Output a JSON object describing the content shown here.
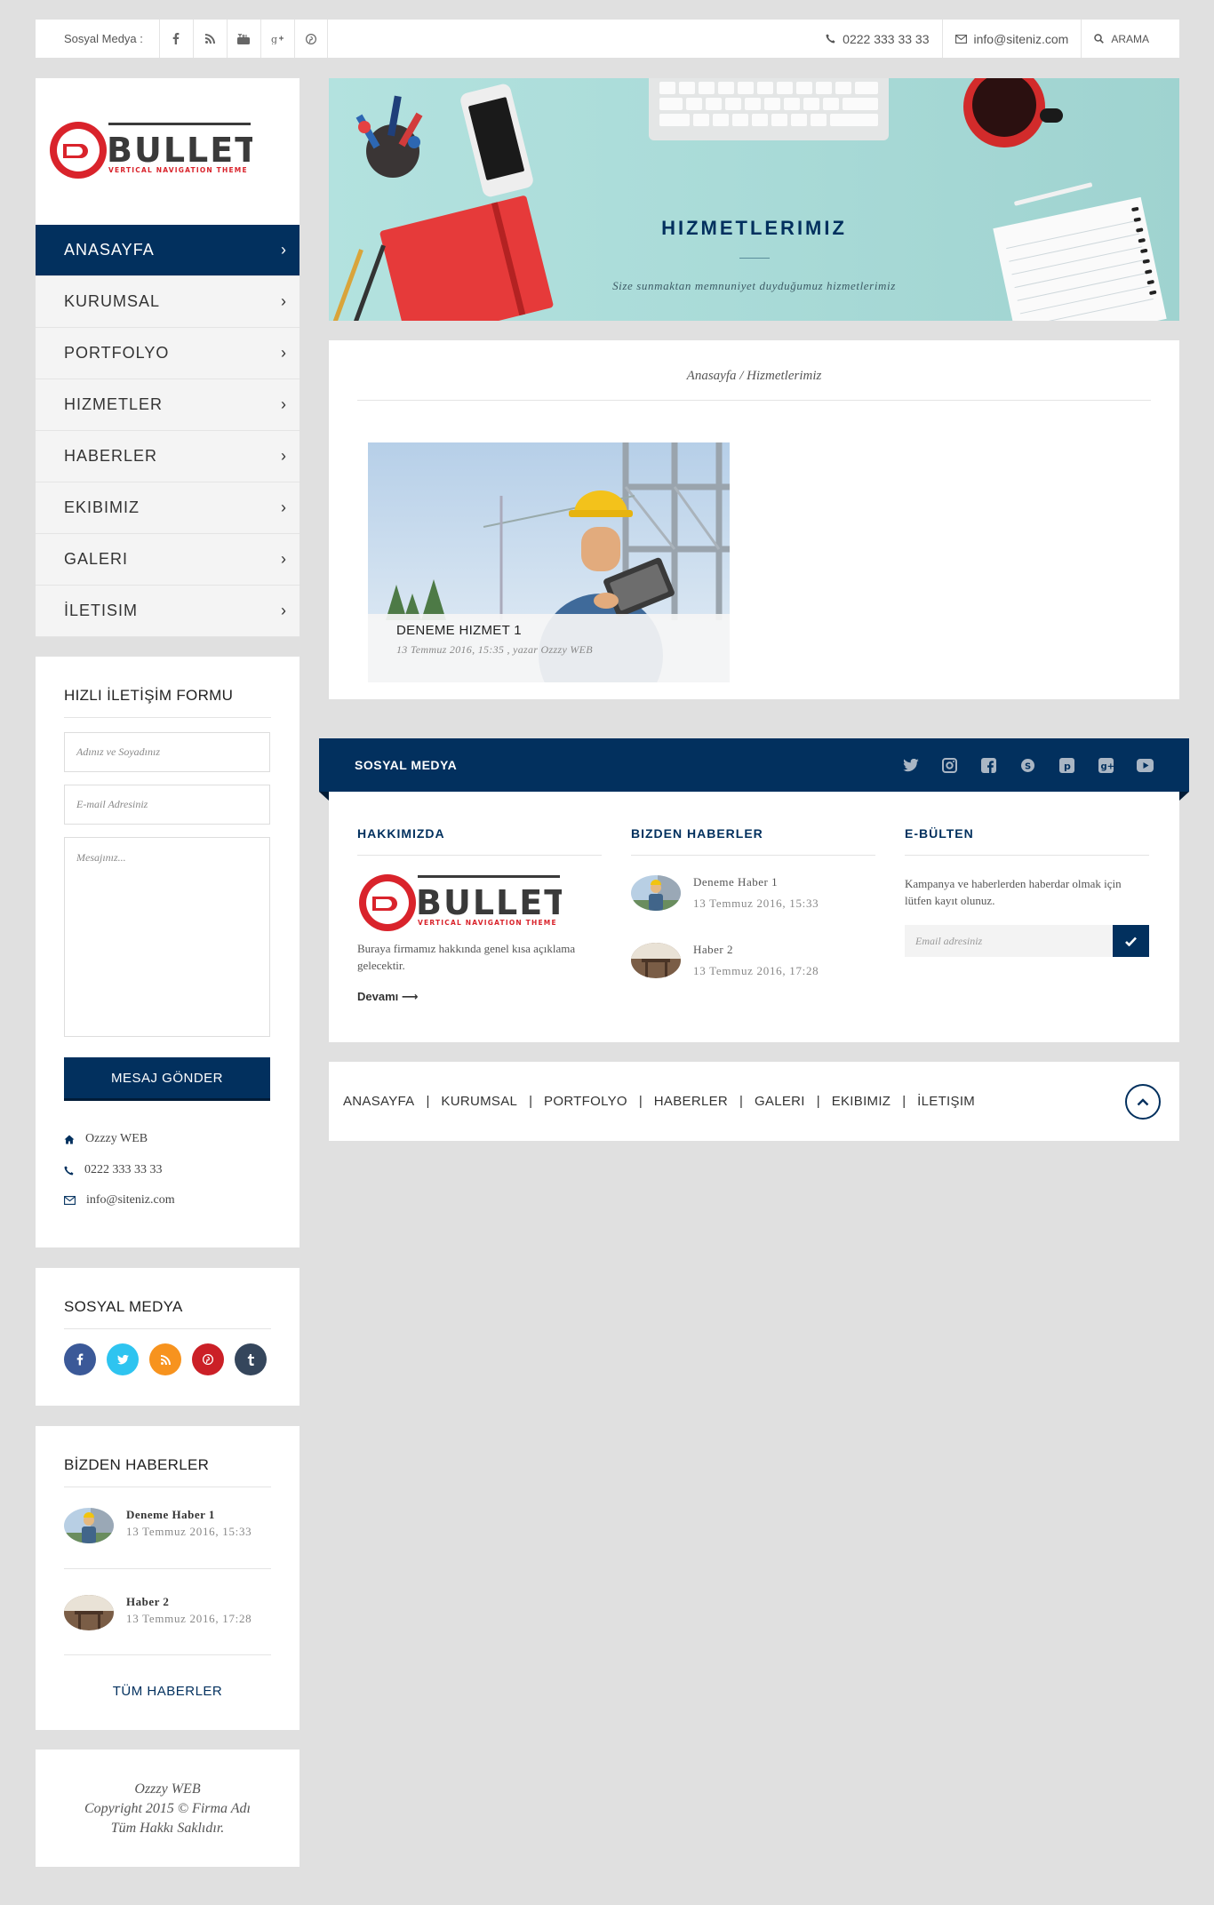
{
  "topbar": {
    "social_label": "Sosyal Medya :",
    "social_icons": [
      "facebook-icon",
      "rss-icon",
      "youtube-icon",
      "google-plus-icon",
      "pinterest-icon"
    ],
    "phone": "0222 333 33 33",
    "email": "info@siteniz.com",
    "search_label": "ARAMA"
  },
  "brand": {
    "name": "BULLET",
    "tagline": "VERTICAL NAVIGATION THEME",
    "primary_color": "#02305e",
    "logo_red": "#d9232b"
  },
  "menu": {
    "items": [
      {
        "label": "ANASAYFA",
        "active": true
      },
      {
        "label": "KURUMSAL",
        "active": false
      },
      {
        "label": "PORTFOLYO",
        "active": false
      },
      {
        "label": "HIZMETLER",
        "active": false
      },
      {
        "label": "HABERLER",
        "active": false
      },
      {
        "label": "EKIBIMIZ",
        "active": false
      },
      {
        "label": "GALERI",
        "active": false
      },
      {
        "label": "İLETISIM",
        "active": false
      }
    ]
  },
  "contact_form": {
    "title": "HIZLI İLETİŞİM FORMU",
    "name_placeholder": "Adınız ve Soyadınız",
    "email_placeholder": "E-mail Adresiniz",
    "message_placeholder": "Mesajınız...",
    "submit_label": "MESAJ GÖNDER",
    "company": "Ozzzy WEB",
    "phone": "0222 333 33 33",
    "email": "info@siteniz.com"
  },
  "social_widget": {
    "title": "SOSYAL MEDYA",
    "icons": [
      {
        "name": "facebook-icon",
        "glyph": "f",
        "color": "#3b5998"
      },
      {
        "name": "twitter-icon",
        "glyph": "t",
        "color": "#1da1f2"
      },
      {
        "name": "rss-icon",
        "glyph": "r",
        "color": "#f7931e"
      },
      {
        "name": "pinterest-icon",
        "glyph": "p",
        "color": "#cb2027"
      },
      {
        "name": "tumblr-icon",
        "glyph": "t",
        "color": "#35465c"
      }
    ]
  },
  "news_widget": {
    "title": "BİZDEN HABERLER",
    "items": [
      {
        "title": "Deneme Haber 1",
        "date": "13 Temmuz 2016, 15:33"
      },
      {
        "title": "Haber 2",
        "date": "13 Temmuz 2016, 17:28"
      }
    ],
    "all_label": "TÜM HABERLER"
  },
  "copyright": {
    "line1": "Ozzzy WEB",
    "line2": "Copyright 2015 © Firma Adı",
    "line3": "Tüm Hakkı Saklıdır."
  },
  "hero": {
    "title": "HIZMETLERIMIZ",
    "subtitle": "Size sunmaktan memnuniyet duyduğumuz hizmetlerimiz"
  },
  "breadcrumb": "Anasayfa / Hizmetlerimiz",
  "services": [
    {
      "title": "DENEME HIZMET 1",
      "meta": "13 Temmuz 2016, 15:35 , yazar Ozzzy WEB"
    }
  ],
  "footer": {
    "band_label": "SOSYAL MEDYA",
    "band_icons": [
      "twitter-icon",
      "instagram-icon",
      "facebook-icon",
      "skype-icon",
      "pinterest-icon",
      "google-plus-icon",
      "youtube-icon"
    ],
    "about_title": "HAKKIMIZDA",
    "about_text": "Buraya firmamız hakkında genel kısa açıklama gelecektir.",
    "more_label": "Devamı ⟶",
    "news_title": "BIZDEN HABERLER",
    "news": [
      {
        "title": "Deneme Haber 1",
        "date": "13 Temmuz 2016, 15:33"
      },
      {
        "title": "Haber 2",
        "date": "13 Temmuz 2016, 17:28"
      }
    ],
    "newsletter_title": "E-BÜLTEN",
    "newsletter_text": "Kampanya ve haberlerden haberdar olmak için lütfen kayıt olunuz.",
    "newsletter_placeholder": "Email adresiniz"
  },
  "bottom_nav": [
    "ANASAYFA",
    "KURUMSAL",
    "PORTFOLYO",
    "HABERLER",
    "GALERI",
    "EKIBIMIZ",
    "İLETIŞIM"
  ]
}
